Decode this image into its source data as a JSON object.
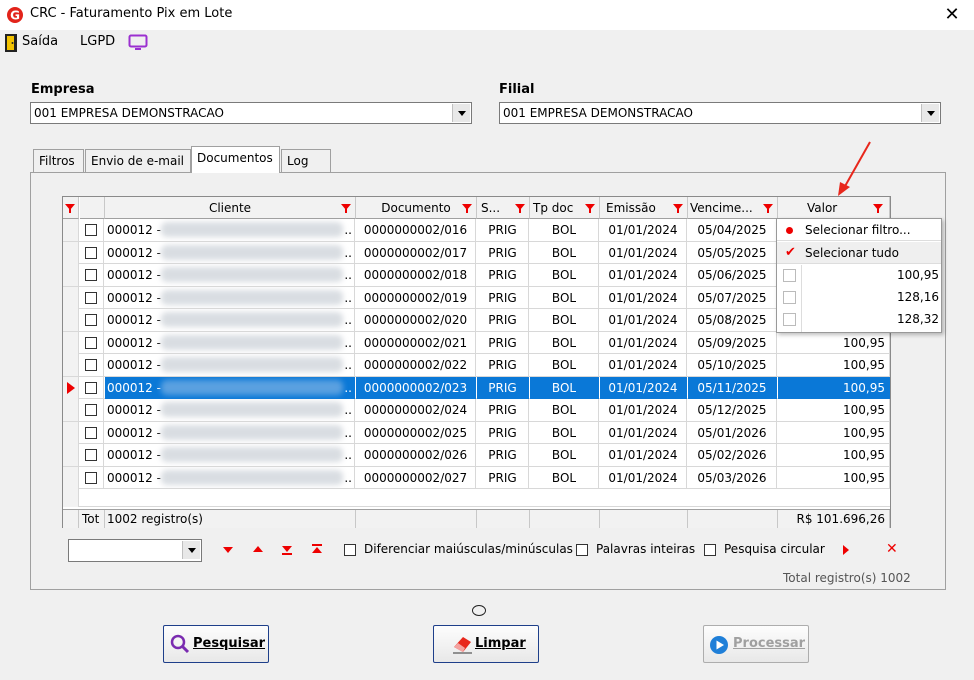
{
  "window": {
    "title": "CRC - Faturamento Pix em Lote",
    "close": "✕"
  },
  "toolbar": {
    "saida": "Saída",
    "lgpd": "LGPD"
  },
  "empresa": {
    "label": "Empresa",
    "value": "001 EMPRESA DEMONSTRACAO"
  },
  "filial": {
    "label": "Filial",
    "value": "001 EMPRESA DEMONSTRACAO"
  },
  "tabs": [
    {
      "label": "Filtros"
    },
    {
      "label": "Envio de e-mail"
    },
    {
      "label": "Documentos"
    },
    {
      "label": "Log"
    }
  ],
  "grid": {
    "columns": [
      "Cliente",
      "Documento",
      "S...",
      "Tp doc",
      "Emissão",
      "Vencime...",
      "Valor"
    ],
    "rows": [
      {
        "cliente": "000012 -",
        "doc": "0000000002/016",
        "s": "PRIG",
        "tp": "BOL",
        "em": "01/01/2024",
        "ve": "05/04/2025",
        "va": ""
      },
      {
        "cliente": "000012 -",
        "doc": "0000000002/017",
        "s": "PRIG",
        "tp": "BOL",
        "em": "01/01/2024",
        "ve": "05/05/2025",
        "va": ""
      },
      {
        "cliente": "000012 -",
        "doc": "0000000002/018",
        "s": "PRIG",
        "tp": "BOL",
        "em": "01/01/2024",
        "ve": "05/06/2025",
        "va": ""
      },
      {
        "cliente": "000012 -",
        "doc": "0000000002/019",
        "s": "PRIG",
        "tp": "BOL",
        "em": "01/01/2024",
        "ve": "05/07/2025",
        "va": ""
      },
      {
        "cliente": "000012 -",
        "doc": "0000000002/020",
        "s": "PRIG",
        "tp": "BOL",
        "em": "01/01/2024",
        "ve": "05/08/2025",
        "va": ""
      },
      {
        "cliente": "000012 -",
        "doc": "0000000002/021",
        "s": "PRIG",
        "tp": "BOL",
        "em": "01/01/2024",
        "ve": "05/09/2025",
        "va": "100,95"
      },
      {
        "cliente": "000012 -",
        "doc": "0000000002/022",
        "s": "PRIG",
        "tp": "BOL",
        "em": "01/01/2024",
        "ve": "05/10/2025",
        "va": "100,95"
      },
      {
        "cliente": "000012 -",
        "doc": "0000000002/023",
        "s": "PRIG",
        "tp": "BOL",
        "em": "01/01/2024",
        "ve": "05/11/2025",
        "va": "100,95"
      },
      {
        "cliente": "000012 -",
        "doc": "0000000002/024",
        "s": "PRIG",
        "tp": "BOL",
        "em": "01/01/2024",
        "ve": "05/12/2025",
        "va": "100,95"
      },
      {
        "cliente": "000012 -",
        "doc": "0000000002/025",
        "s": "PRIG",
        "tp": "BOL",
        "em": "01/01/2024",
        "ve": "05/01/2026",
        "va": "100,95"
      },
      {
        "cliente": "000012 -",
        "doc": "0000000002/026",
        "s": "PRIG",
        "tp": "BOL",
        "em": "01/01/2024",
        "ve": "05/02/2026",
        "va": "100,95"
      },
      {
        "cliente": "000012 -",
        "doc": "0000000002/027",
        "s": "PRIG",
        "tp": "BOL",
        "em": "01/01/2024",
        "ve": "05/03/2026",
        "va": "100,95"
      }
    ],
    "footer": {
      "tot": "Tot",
      "count": "1002 registro(s)",
      "sum": "R$ 101.696,26"
    }
  },
  "popup": {
    "select_filter": "Selecionar filtro...",
    "select_all": "Selecionar tudo",
    "values": [
      "100,95",
      "128,16",
      "128,32"
    ]
  },
  "search": {
    "diferenciar": "Diferenciar maiúsculas/minúsculas",
    "palavras": "Palavras inteiras",
    "circular": "Pesquisa circular",
    "close": "✕"
  },
  "total_registros": "Total registro(s) 1002",
  "buttons": {
    "pesquisar": "Pesquisar",
    "limpar": "Limpar",
    "processar": "Processar"
  }
}
